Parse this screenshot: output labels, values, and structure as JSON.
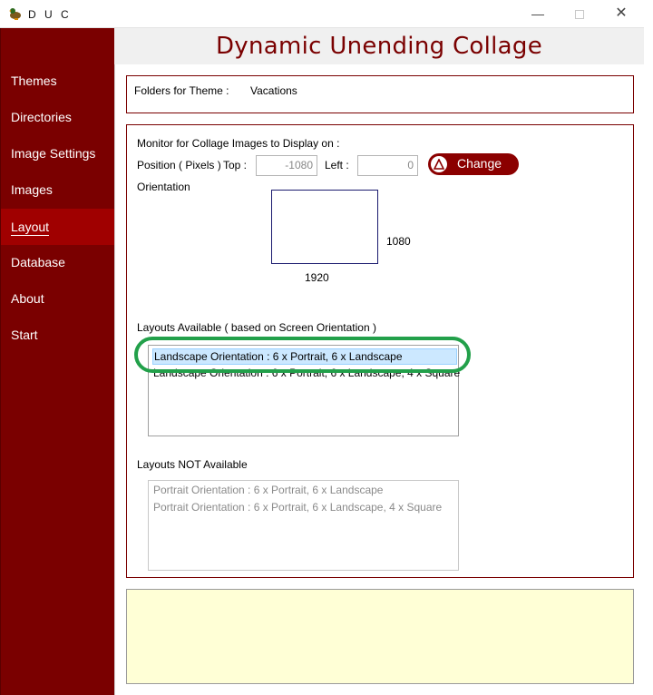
{
  "window": {
    "title": "D U C",
    "minimize_glyph": "—",
    "close_glyph": "✕"
  },
  "header": {
    "title": "Dynamic Unending Collage"
  },
  "sidebar": {
    "items": [
      {
        "label": "Themes"
      },
      {
        "label": "Directories"
      },
      {
        "label": "Image Settings"
      },
      {
        "label": "Images"
      },
      {
        "label": "Layout",
        "active": true
      },
      {
        "label": "Database"
      },
      {
        "label": "About"
      },
      {
        "label": "Start"
      }
    ]
  },
  "theme_panel": {
    "label": "Folders for Theme :",
    "value": "Vacations"
  },
  "monitor": {
    "heading": "Monitor for Collage Images to Display on :",
    "position_label": "Position ( Pixels )",
    "top_label": "Top :",
    "top_value": "-1080",
    "left_label": "Left :",
    "left_value": "0",
    "change_label": "Change",
    "orientation_label": "Orientation",
    "width_value": "1920",
    "height_value": "1080"
  },
  "layouts_available": {
    "heading": "Layouts Available ( based on Screen Orientation )",
    "items": [
      "Landscape Orientation : 6 x Portrait, 6 x Landscape",
      "Landscape Orientation : 6 x Portrait, 6 x Landscape, 4 x Square"
    ],
    "selected": "Landscape Orientation : 6 x Portrait, 6 x Landscape"
  },
  "layouts_not_available": {
    "heading": "Layouts NOT Available",
    "items": [
      "Portrait Orientation : 6 x Portrait, 6 x Landscape",
      "Portrait Orientation : 6 x Portrait, 6 x Landscape, 4 x Square"
    ]
  },
  "colors": {
    "sidebar": "#7a0000",
    "sidebar_active": "#a00000",
    "accent": "#7a0000",
    "message_bg": "#ffffd6",
    "highlight_ring": "#22a04a"
  },
  "icons": {
    "app": "duck-icon",
    "change_button": "warning-triangle-icon"
  }
}
